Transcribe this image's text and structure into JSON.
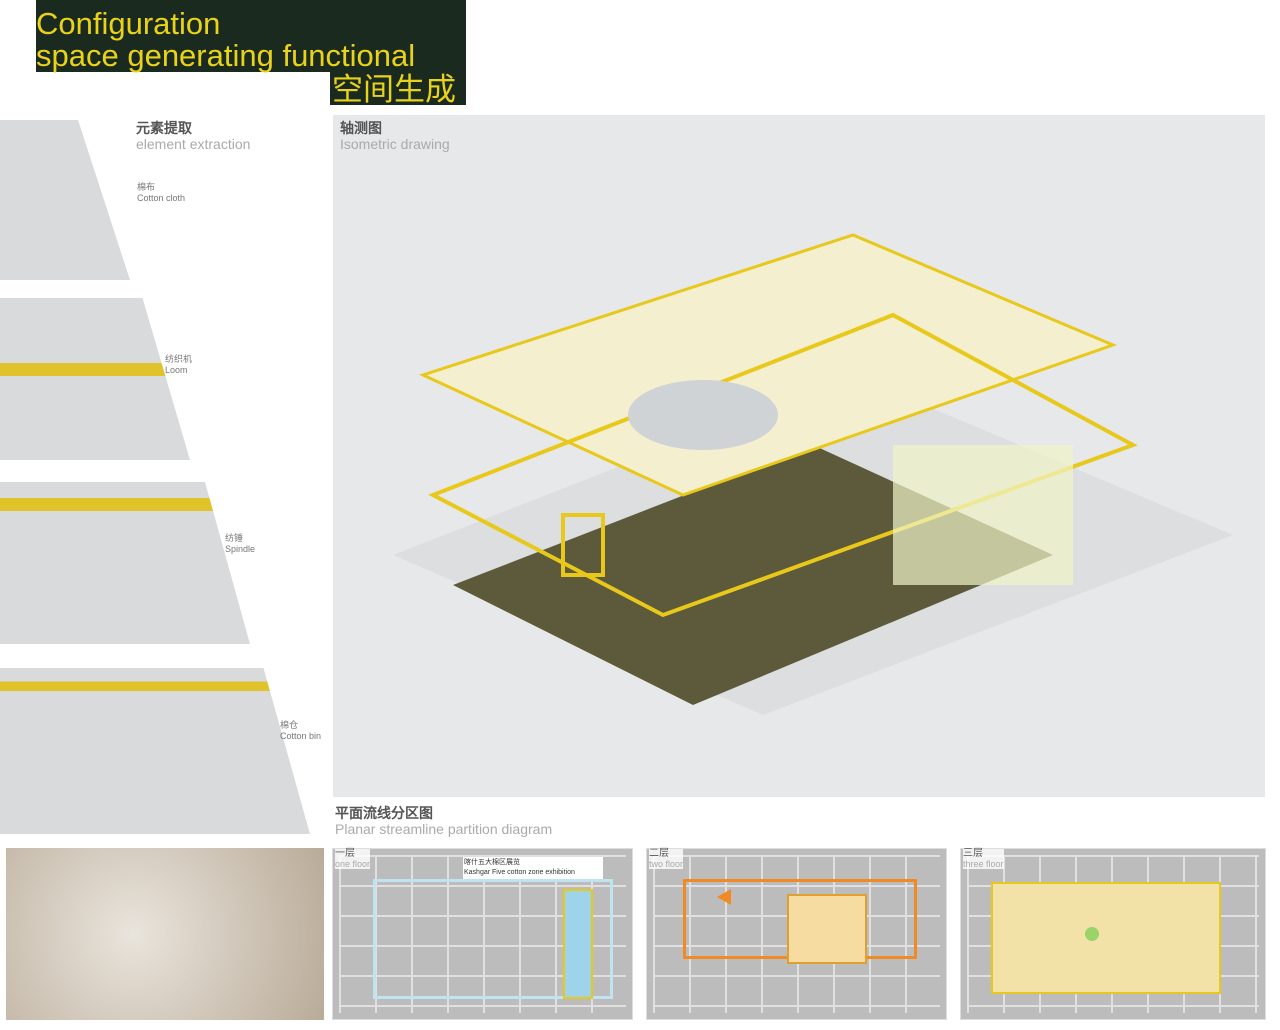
{
  "title": {
    "line1": "Configuration",
    "line2": "space generating functional",
    "line3": "空间生成"
  },
  "element_extraction": {
    "heading_cn": "元素提取",
    "heading_en": "element extraction",
    "items": [
      {
        "cn": "棉布",
        "en": "Cotton cloth"
      },
      {
        "cn": "纺织机",
        "en": "Loom"
      },
      {
        "cn": "纺锤",
        "en": "Spindle"
      },
      {
        "cn": "棉仓",
        "en": "Cotton bin"
      }
    ]
  },
  "isometric": {
    "heading_cn": "轴测图",
    "heading_en": "Isometric drawing"
  },
  "planar": {
    "heading_cn": "平面流线分区图",
    "heading_en": "Planar streamline partition diagram",
    "floors": [
      {
        "cn": "一层",
        "en": "one floor",
        "zone_cn": "喀什五大棉区展览",
        "zone_en": "Kashgar Five cotton zone exhibition"
      },
      {
        "cn": "二层",
        "en": "two floor"
      },
      {
        "cn": "三层",
        "en": "three floor"
      }
    ]
  },
  "colors": {
    "accent": "#e8c81a",
    "title_bg": "#1a2a1f",
    "title_text": "#e8d21a",
    "flow": "#f08a24"
  }
}
